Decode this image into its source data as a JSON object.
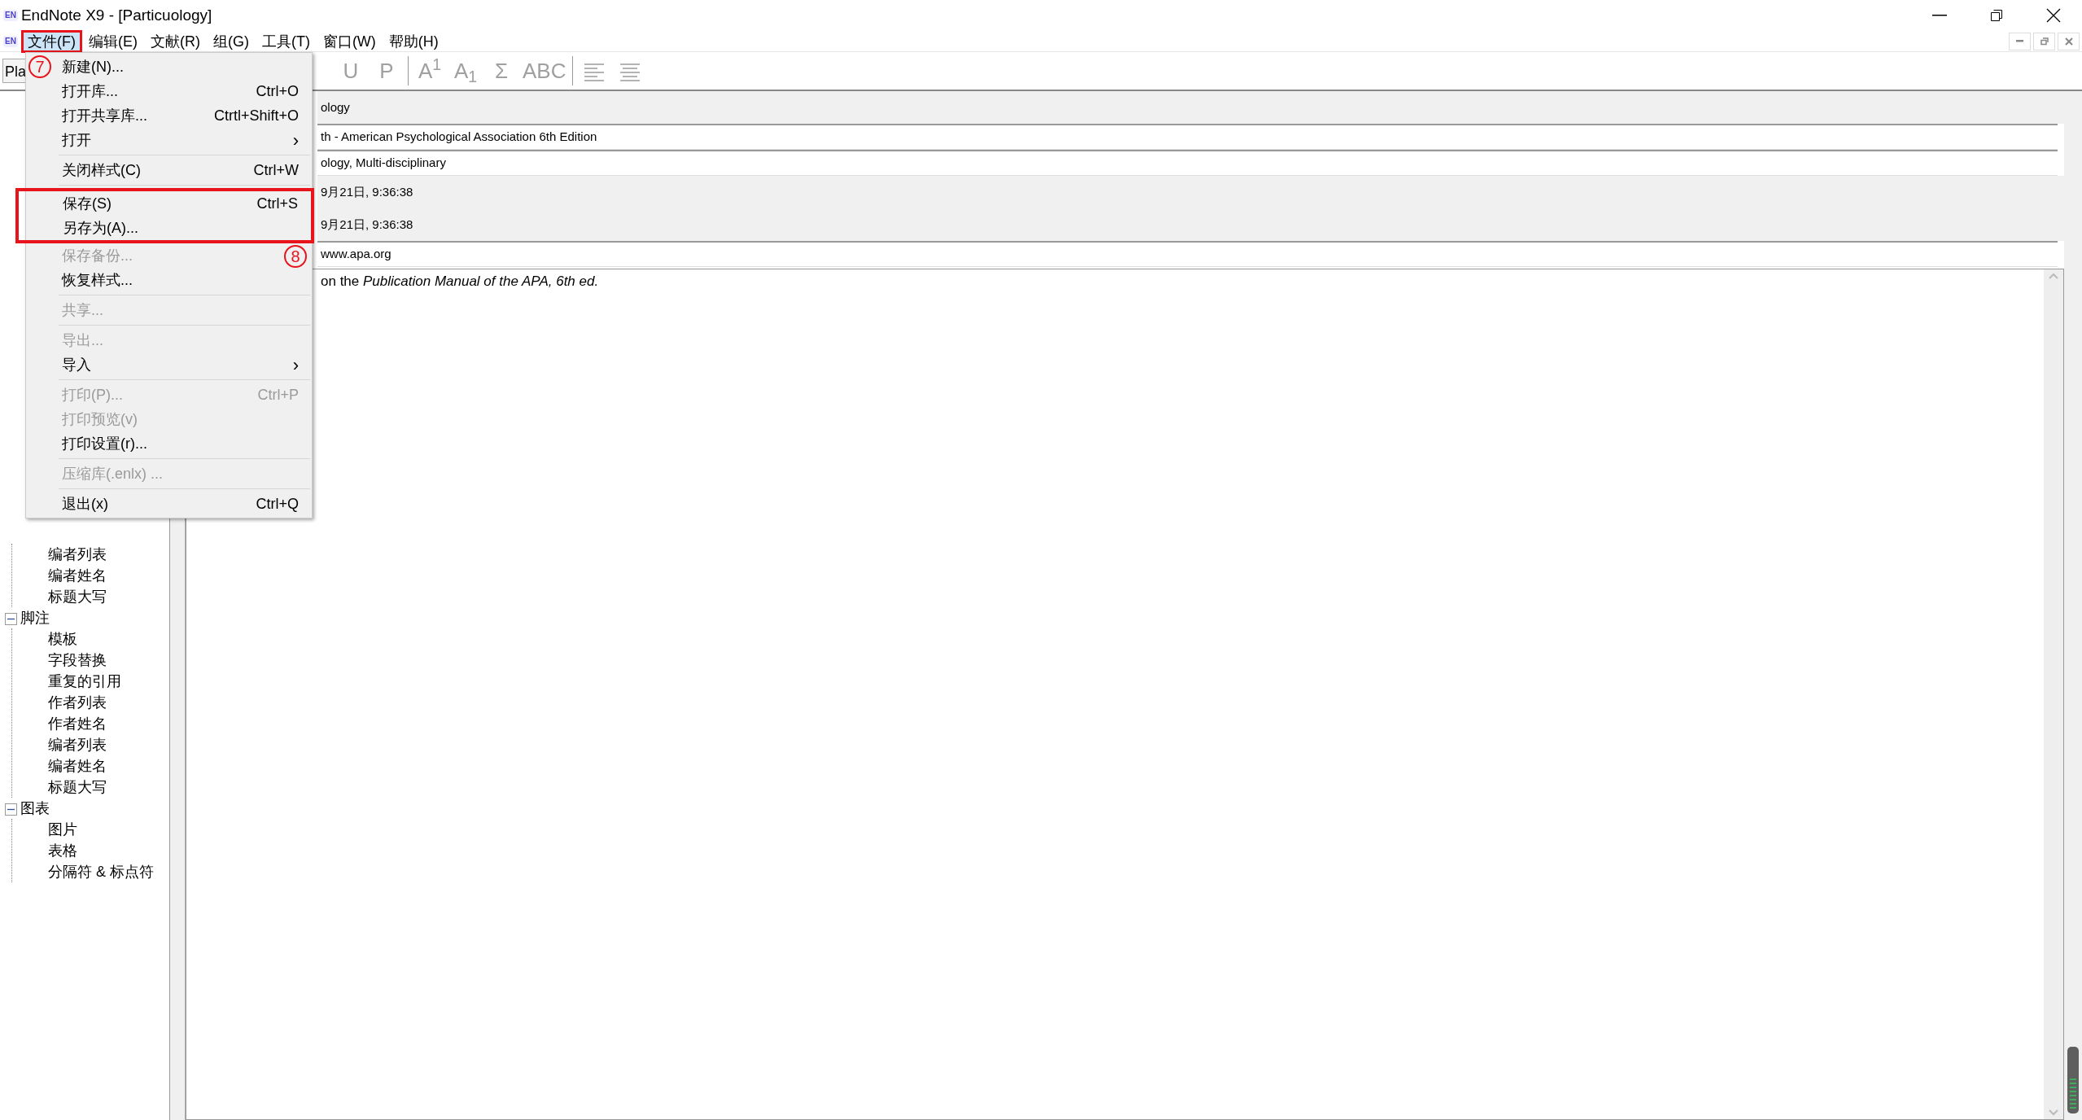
{
  "window": {
    "title": "EndNote X9 - [Particuology]",
    "logo": "EN"
  },
  "menu_bar": {
    "logo": "EN",
    "items": [
      {
        "label": "文件(F)",
        "selected": true,
        "marked": true
      },
      {
        "label": "编辑(E)",
        "selected": false,
        "marked": false
      },
      {
        "label": "文献(R)",
        "selected": false,
        "marked": false
      },
      {
        "label": "组(G)",
        "selected": false,
        "marked": false
      },
      {
        "label": "工具(T)",
        "selected": false,
        "marked": false
      },
      {
        "label": "窗口(W)",
        "selected": false,
        "marked": false
      },
      {
        "label": "帮助(H)",
        "selected": false,
        "marked": false
      }
    ]
  },
  "toolbar": {
    "style_field": {
      "value": "Pla"
    },
    "buttons": [
      {
        "kind": "text",
        "label": "U",
        "disabled": true
      },
      {
        "kind": "text",
        "label": "P",
        "disabled": true
      },
      {
        "kind": "separator"
      },
      {
        "kind": "text",
        "label": "A$^{1}$",
        "disabled": true
      },
      {
        "kind": "text",
        "label": "A$_{1}$",
        "disabled": true
      },
      {
        "kind": "text",
        "label": "Σ",
        "disabled": true
      },
      {
        "kind": "text",
        "label": "ABC",
        "disabled": true
      },
      {
        "kind": "separator"
      },
      {
        "kind": "align-left",
        "disabled": true
      },
      {
        "kind": "align-center",
        "disabled": true
      }
    ]
  },
  "file_menu": {
    "groups": [
      {
        "items": [
          {
            "label": "新建(N)...",
            "disabled": false,
            "marked": false,
            "callout": "7"
          },
          {
            "label": "打开库...",
            "shortcut": "Ctrl+O",
            "disabled": false,
            "marked": false
          },
          {
            "label": "打开共享库...",
            "shortcut": "Ctrtl+Shift+O",
            "disabled": false,
            "marked": false
          },
          {
            "label": "打开",
            "arrow": "›",
            "disabled": false,
            "marked": false
          }
        ]
      },
      {
        "items": [
          {
            "label": "关闭样式(C)",
            "shortcut": "Ctrl+W",
            "disabled": false,
            "marked": false
          }
        ]
      },
      {
        "items": [
          {
            "label": "保存(S)",
            "shortcut": "Ctrl+S",
            "disabled": false,
            "marked": true
          },
          {
            "label": "另存为(A)...",
            "disabled": false,
            "marked": true
          },
          {
            "label": "保存备份...",
            "disabled": true,
            "marked": false,
            "callout": "8"
          },
          {
            "label": "恢复样式...",
            "disabled": false,
            "marked": false
          }
        ]
      },
      {
        "items": [
          {
            "label": "共享...",
            "disabled": true,
            "marked": false
          }
        ]
      },
      {
        "items": [
          {
            "label": "导出...",
            "disabled": true,
            "marked": false
          },
          {
            "label": "导入",
            "arrow": "›",
            "disabled": false,
            "marked": false
          }
        ]
      },
      {
        "items": [
          {
            "label": "打印(P)...",
            "shortcut": "Ctrl+P",
            "disabled": true,
            "marked": false
          },
          {
            "label": "打印预览(v)",
            "disabled": true,
            "marked": false
          },
          {
            "label": "打印设置(r)...",
            "disabled": false,
            "marked": false
          }
        ]
      },
      {
        "items": [
          {
            "label": "压缩库(.enlx) ...",
            "disabled": true,
            "marked": false
          }
        ]
      },
      {
        "items": [
          {
            "label": "退出(x)",
            "shortcut": "Ctrl+Q",
            "disabled": false,
            "marked": false
          }
        ]
      }
    ]
  },
  "tree": {
    "items": [
      {
        "expanded": true,
        "children": [
          {
            "label": "编者列表"
          },
          {
            "label": "编者姓名"
          },
          {
            "label": "标题大写"
          }
        ]
      },
      {
        "label": "脚注",
        "expanded": true,
        "children": [
          {
            "label": "模板"
          },
          {
            "label": "字段替换"
          },
          {
            "label": "重复的引用"
          },
          {
            "label": "作者列表"
          },
          {
            "label": "作者姓名"
          },
          {
            "label": "编者列表"
          },
          {
            "label": "编者姓名"
          },
          {
            "label": "标题大写"
          }
        ]
      },
      {
        "label": "图表",
        "expanded": true,
        "children": [
          {
            "label": "图片"
          },
          {
            "label": "表格"
          },
          {
            "label": "分隔符 & 标点符"
          }
        ]
      }
    ]
  },
  "details": {
    "rows": [
      {
        "kind": "info",
        "value": "ology"
      },
      {
        "kind": "field",
        "value": "th - American Psychological Association 6th Edition"
      },
      {
        "kind": "field",
        "value": "ology, Multi-disciplinary"
      },
      {
        "kind": "info",
        "value": "9月21日, 9:36:38"
      },
      {
        "kind": "info",
        "value": "9月21日, 9:36:38"
      },
      {
        "kind": "field",
        "value": "www.apa.org"
      }
    ],
    "notes": "on the *Publication Manual of the APA, 6th ed.*"
  }
}
